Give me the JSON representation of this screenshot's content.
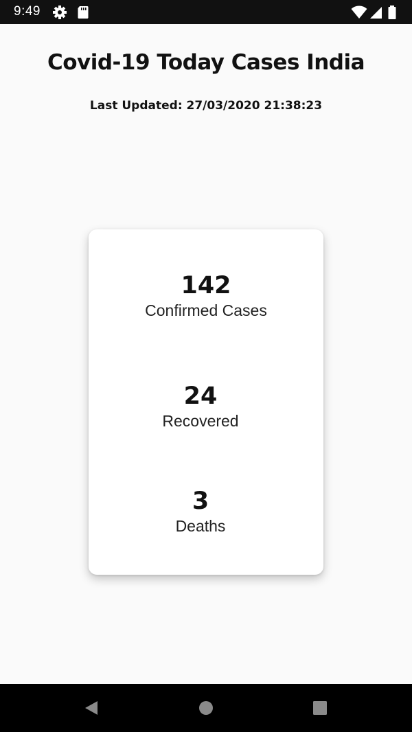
{
  "status_bar": {
    "time": "9:49",
    "icons": [
      "gear-icon",
      "sd-card-icon",
      "wifi-icon",
      "cell-signal-icon",
      "battery-icon"
    ]
  },
  "header": {
    "title": "Covid-19 Today Cases India",
    "last_updated": "Last Updated: 27/03/2020 21:38:23"
  },
  "stats": {
    "confirmed": {
      "value": "142",
      "label": "Confirmed Cases"
    },
    "recovered": {
      "value": "24",
      "label": "Recovered"
    },
    "deaths": {
      "value": "3",
      "label": "Deaths"
    }
  },
  "nav_bar": {
    "icons": [
      "back-icon",
      "home-icon",
      "recents-icon"
    ]
  },
  "colors": {
    "background": "#fafafa",
    "card": "#ffffff",
    "text": "#111111",
    "status_bar": "#111111",
    "nav_bar": "#000000"
  }
}
